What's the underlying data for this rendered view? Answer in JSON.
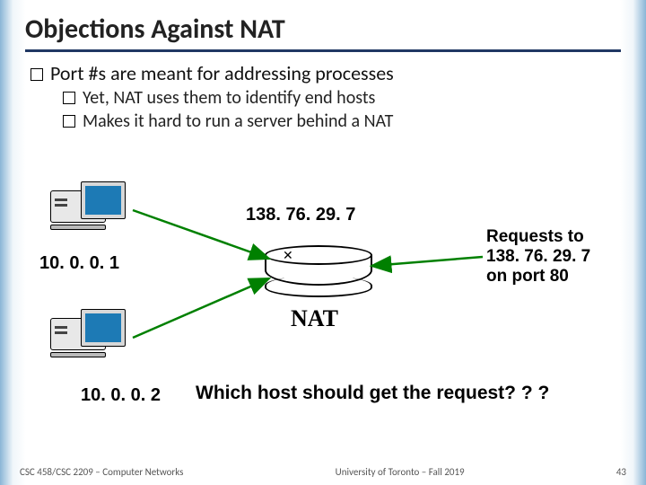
{
  "title": "Objections Against NAT",
  "bullets": {
    "main": "Port #s are meant for addressing processes",
    "sub1": "Yet, NAT uses them to identify end hosts",
    "sub2": "Makes it hard to run a server behind a NAT"
  },
  "diagram": {
    "public_ip": "138. 76. 29. 7",
    "host1_ip": "10. 0. 0. 1",
    "host2_ip": "10. 0. 0. 2",
    "nat_label": "NAT",
    "request_line1": "Requests to",
    "request_line2": "138. 76. 29. 7",
    "request_line3": "on port 80",
    "question": "Which host should get the request? ? ?"
  },
  "footer": {
    "left": "CSC 458/CSC 2209 – Computer Networks",
    "center": "University of Toronto – Fall 2019",
    "right": "43"
  }
}
